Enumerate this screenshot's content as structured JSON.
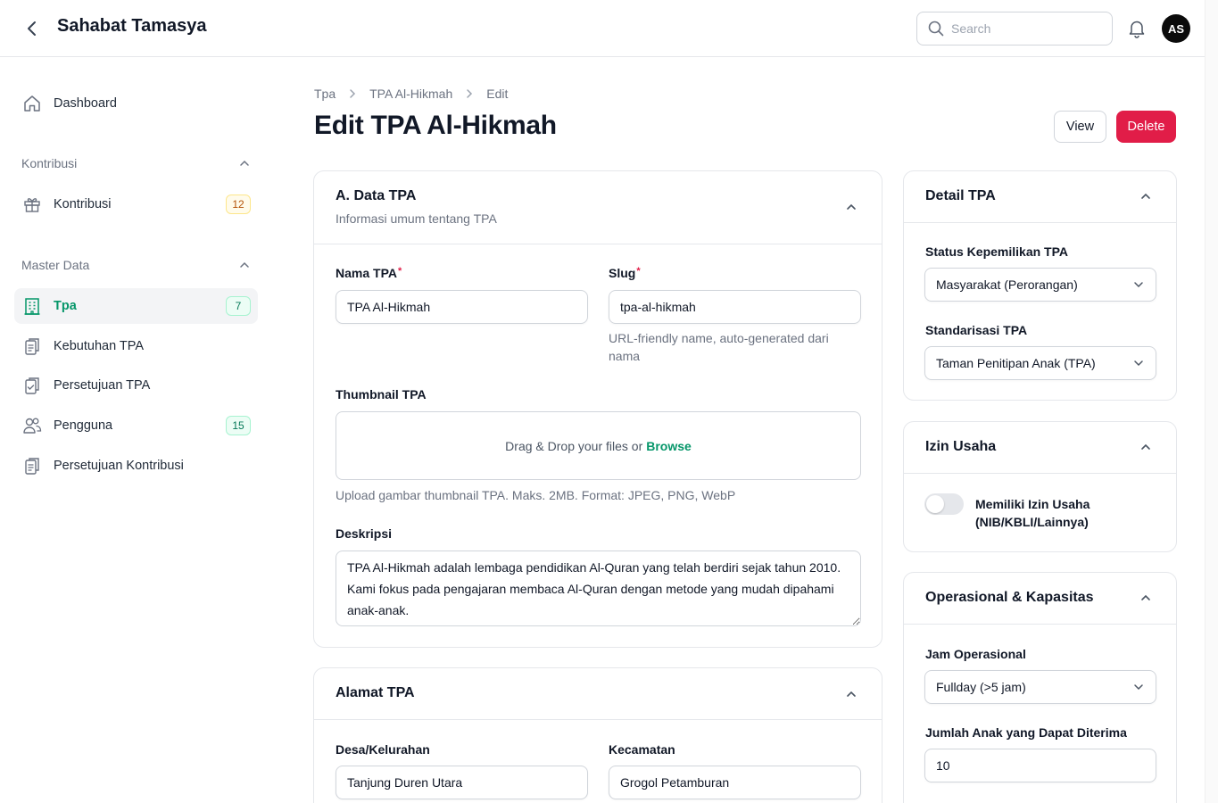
{
  "header": {
    "title": "Sahabat Tamasya",
    "search_placeholder": "Search",
    "avatar_initials": "AS"
  },
  "sidebar": {
    "dashboard": "Dashboard",
    "groups": [
      {
        "label": "Kontribusi",
        "items": [
          {
            "label": "Kontribusi",
            "badge": "12"
          }
        ]
      },
      {
        "label": "Master Data",
        "items": [
          {
            "label": "Tpa",
            "badge": "7",
            "active": true
          },
          {
            "label": "Kebutuhan TPA"
          },
          {
            "label": "Persetujuan TPA"
          },
          {
            "label": "Pengguna",
            "badge": "15"
          },
          {
            "label": "Persetujuan Kontribusi"
          }
        ]
      }
    ]
  },
  "breadcrumb": [
    "Tpa",
    "TPA Al-Hikmah",
    "Edit"
  ],
  "page": {
    "title": "Edit TPA Al-Hikmah",
    "view_label": "View",
    "delete_label": "Delete"
  },
  "data_tpa": {
    "title": "A. Data TPA",
    "subtitle": "Informasi umum tentang TPA",
    "nama_label": "Nama TPA",
    "nama_value": "TPA Al-Hikmah",
    "slug_label": "Slug",
    "slug_value": "tpa-al-hikmah",
    "slug_help": "URL-friendly name, auto-generated dari nama",
    "required_mark": "*",
    "thumbnail_label": "Thumbnail TPA",
    "dropzone_text": "Drag & Drop your files or",
    "browse_label": "Browse",
    "thumbnail_help": "Upload gambar thumbnail TPA. Maks. 2MB. Format: JPEG, PNG, WebP",
    "deskripsi_label": "Deskripsi",
    "deskripsi_value": "TPA Al-Hikmah adalah lembaga pendidikan Al-Quran yang telah berdiri sejak tahun 2010. Kami fokus pada pengajaran membaca Al-Quran dengan metode yang mudah dipahami anak-anak."
  },
  "alamat": {
    "title": "Alamat TPA",
    "desa_label": "Desa/Kelurahan",
    "desa_value": "Tanjung Duren Utara",
    "kecamatan_label": "Kecamatan",
    "kecamatan_value": "Grogol Petamburan"
  },
  "detail": {
    "title": "Detail TPA",
    "status_label": "Status Kepemilikan TPA",
    "status_value": "Masyarakat (Perorangan)",
    "standar_label": "Standarisasi TPA",
    "standar_value": "Taman Penitipan Anak (TPA)"
  },
  "izin": {
    "title": "Izin Usaha",
    "toggle_label": "Memiliki Izin Usaha (NIB/KBLI/Lainnya)",
    "toggle_on": false
  },
  "operasional": {
    "title": "Operasional & Kapasitas",
    "jam_label": "Jam Operasional",
    "jam_value": "Fullday (>5 jam)",
    "jumlah_label": "Jumlah Anak yang Dapat Diterima",
    "jumlah_value": "10"
  },
  "colors": {
    "accent_green": "#059669",
    "delete_red": "#e11d48"
  }
}
